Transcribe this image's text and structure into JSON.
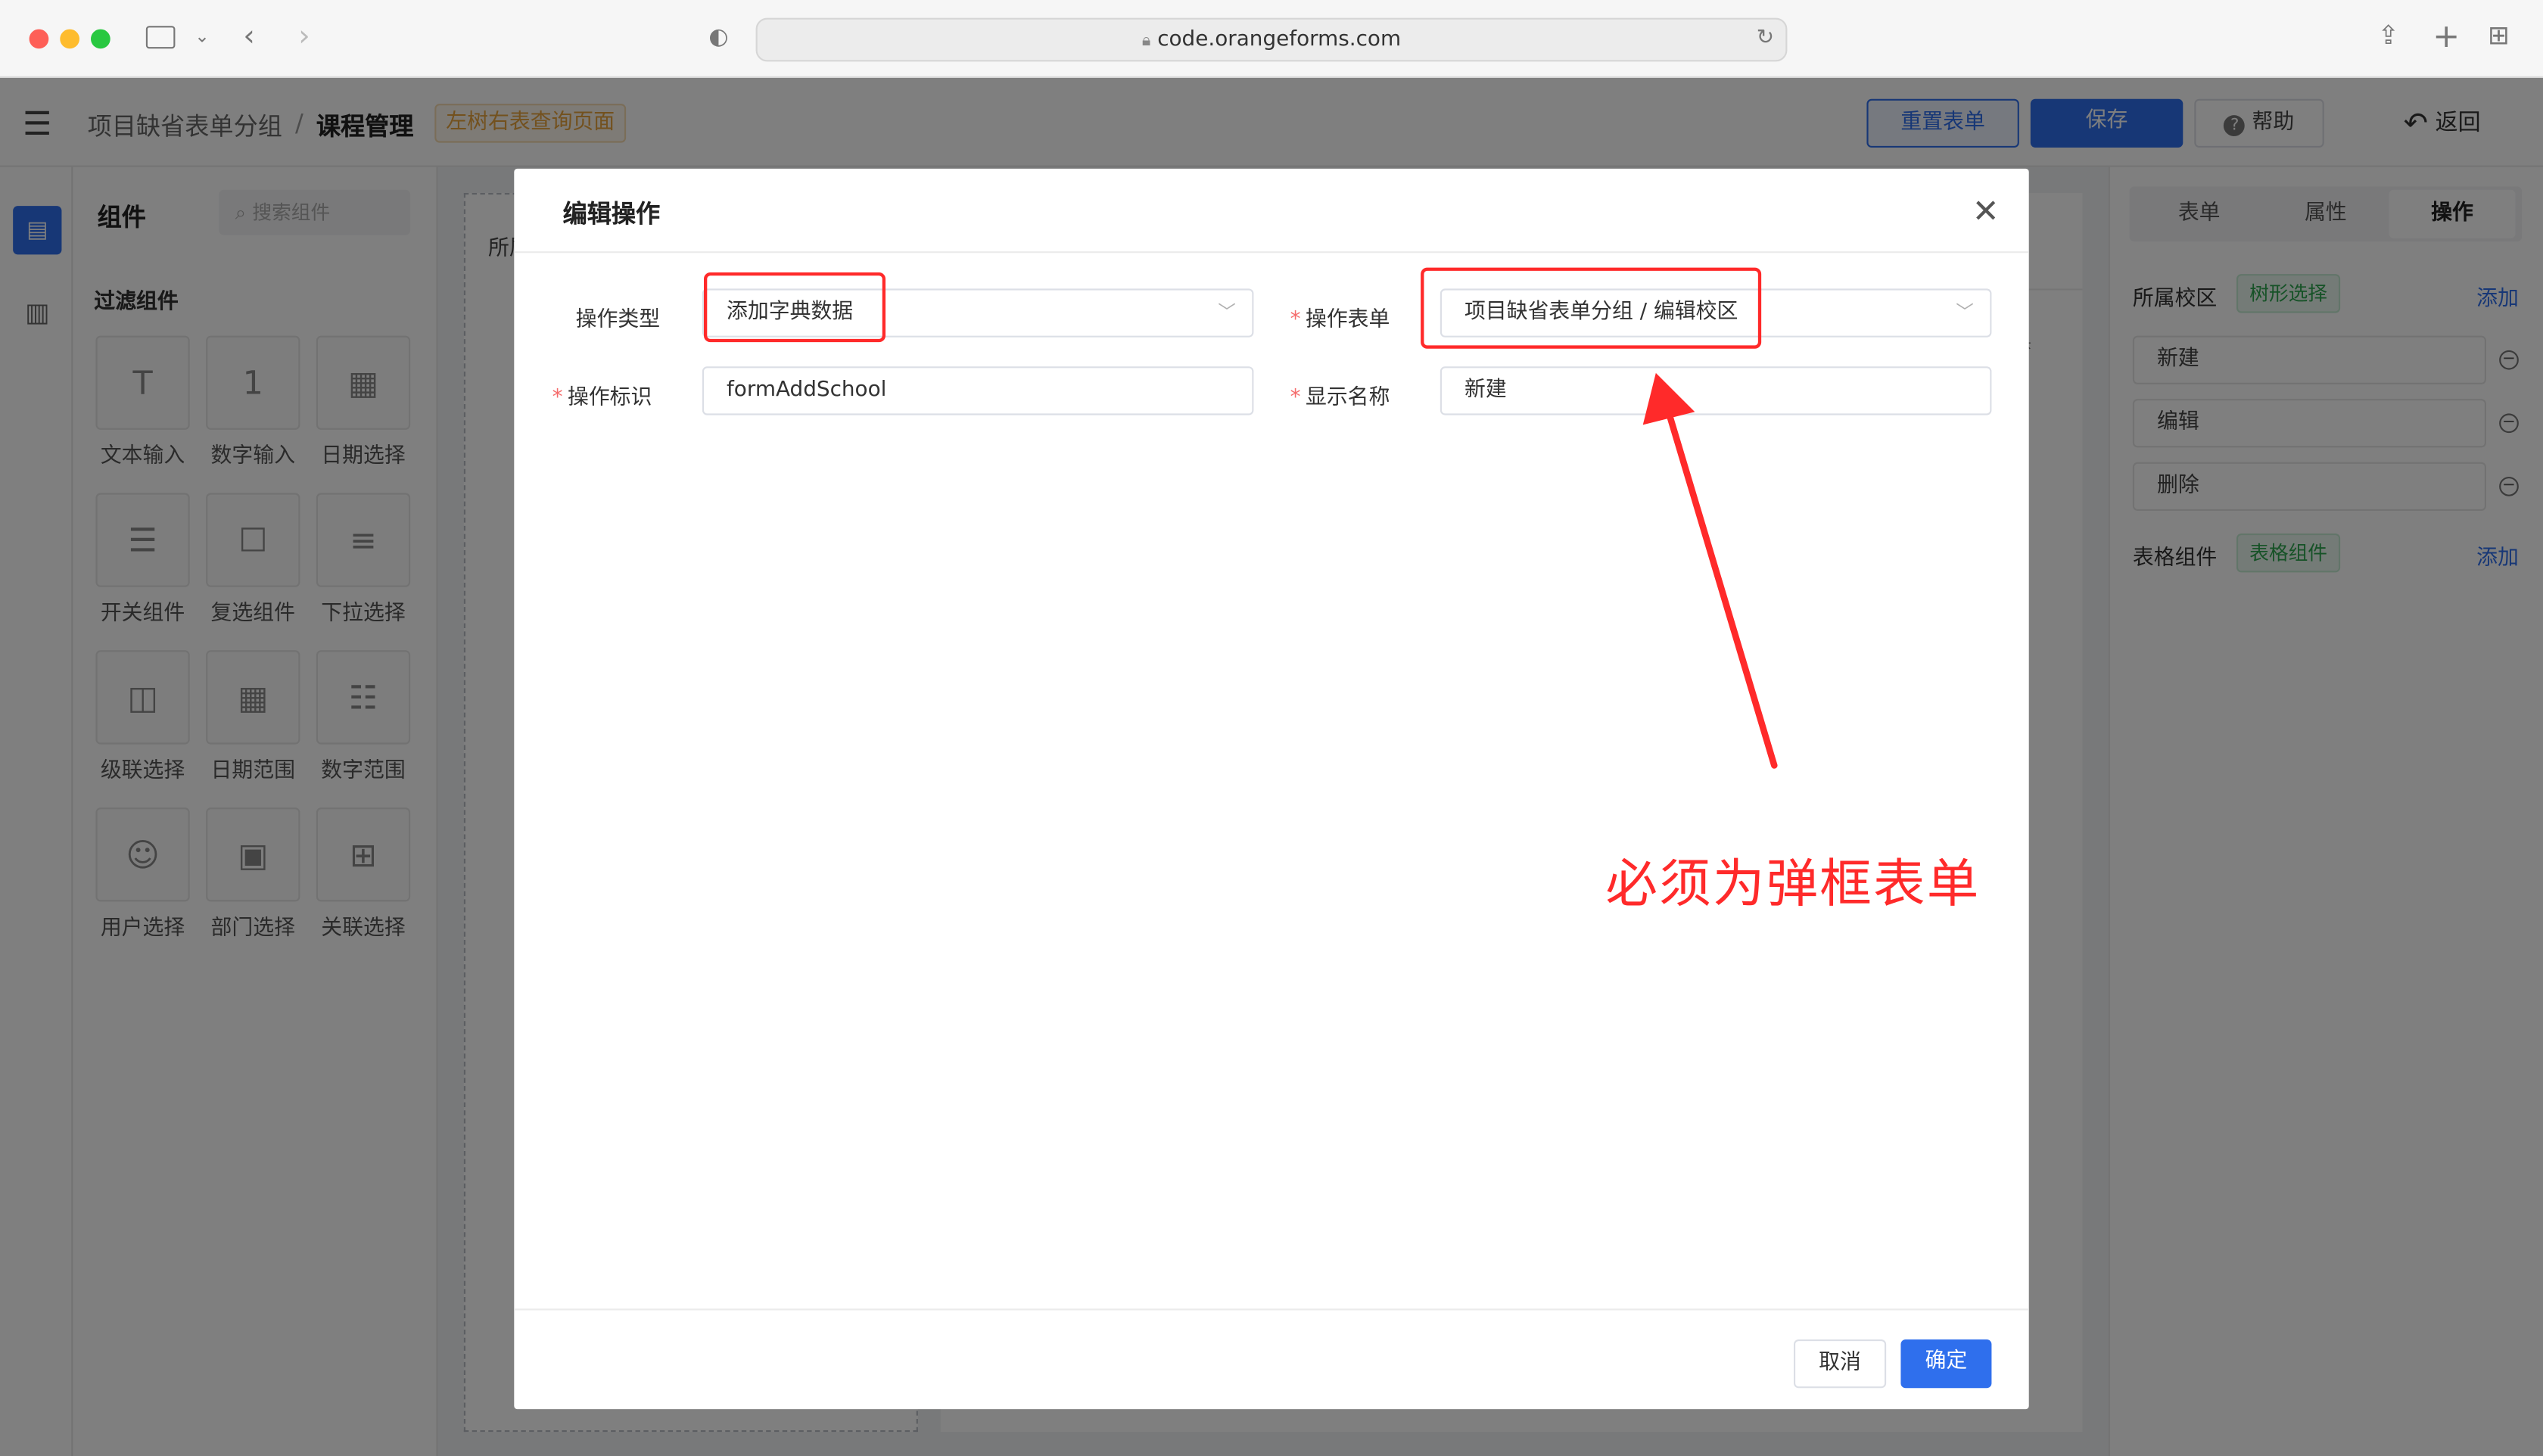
{
  "browser": {
    "url": "code.orangeforms.com"
  },
  "topbar": {
    "breadcrumb_root": "项目缺省表单分组",
    "breadcrumb_sep": "/",
    "breadcrumb_current": "课程管理",
    "page_tag": "左树右表查询页面",
    "reset_label": "重置表单",
    "save_label": "保存",
    "help_label": "帮助",
    "back_label": "返回"
  },
  "palette": {
    "title": "组件",
    "search_placeholder": "搜索组件",
    "group_title": "过滤组件",
    "items": [
      {
        "label": "文本输入",
        "icon": "text-input-icon",
        "glyph": "T"
      },
      {
        "label": "数字输入",
        "icon": "number-input-icon",
        "glyph": "1"
      },
      {
        "label": "日期选择",
        "icon": "date-picker-icon",
        "glyph": "▦"
      },
      {
        "label": "开关组件",
        "icon": "switch-icon",
        "glyph": "☰"
      },
      {
        "label": "复选组件",
        "icon": "checkbox-icon",
        "glyph": "☐"
      },
      {
        "label": "下拉选择",
        "icon": "dropdown-icon",
        "glyph": "≡"
      },
      {
        "label": "级联选择",
        "icon": "cascader-icon",
        "glyph": "◫"
      },
      {
        "label": "日期范围",
        "icon": "date-range-icon",
        "glyph": "▦"
      },
      {
        "label": "数字范围",
        "icon": "number-range-icon",
        "glyph": "☷"
      },
      {
        "label": "用户选择",
        "icon": "user-select-icon",
        "glyph": "☺"
      },
      {
        "label": "部门选择",
        "icon": "department-select-icon",
        "glyph": "▣"
      },
      {
        "label": "关联选择",
        "icon": "relation-select-icon",
        "glyph": "⊞"
      }
    ]
  },
  "canvas": {
    "partial_label": "所属"
  },
  "props": {
    "tabs": [
      "表单",
      "属性",
      "操作"
    ],
    "section1_label": "所属校区",
    "section1_tag": "树形选择",
    "add_label": "添加",
    "rows": [
      "新建",
      "编辑",
      "删除"
    ],
    "section2_label": "表格组件",
    "section2_tag": "表格组件"
  },
  "dialog": {
    "title": "编辑操作",
    "type_label": "操作类型",
    "type_value": "添加字典数据",
    "form_label": "操作表单",
    "form_value": "项目缺省表单分组 / 编辑校区",
    "id_label": "操作标识",
    "id_value": "formAddSchool",
    "name_label": "显示名称",
    "name_value": "新建",
    "cancel_label": "取消",
    "confirm_label": "确定"
  },
  "annotation": {
    "text": "必须为弹框表单",
    "color": "#ff2a2a"
  },
  "colors": {
    "primary": "#2f6fed",
    "dark_primary": "#1f3a8f",
    "tag_green": "#2da44e",
    "tag_orange": "#e6a23c"
  }
}
